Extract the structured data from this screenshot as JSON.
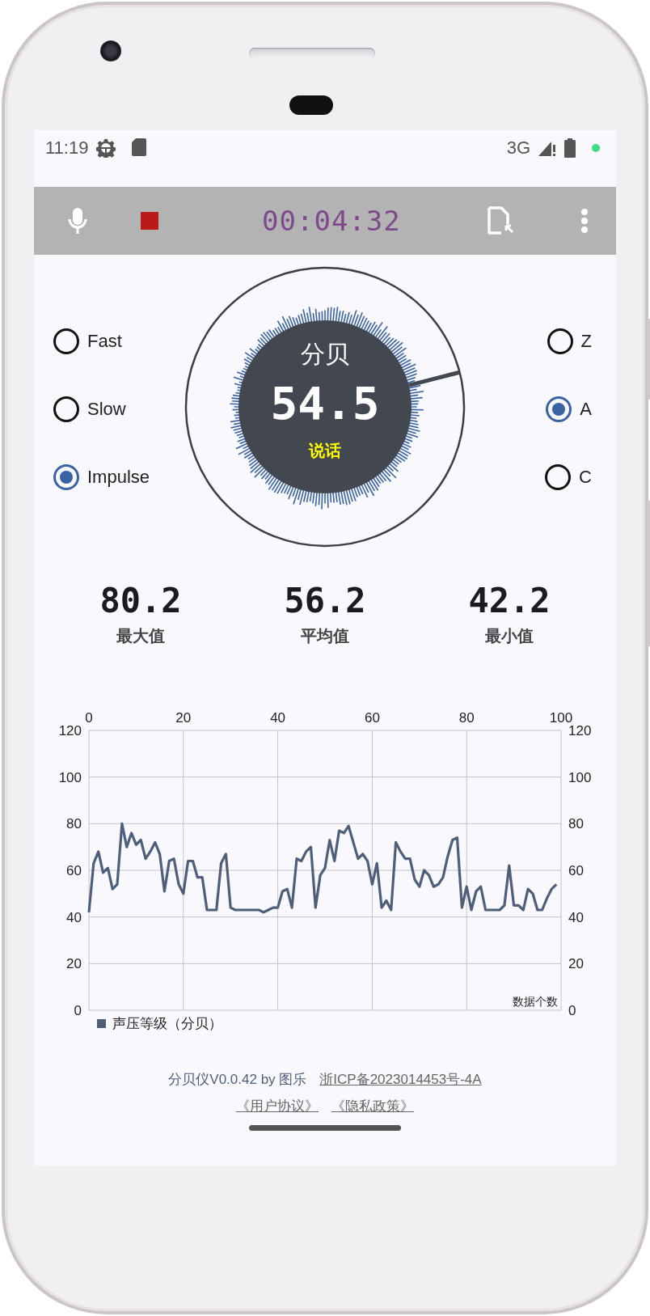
{
  "status_bar": {
    "time": "11:19",
    "network": "3G"
  },
  "app_bar": {
    "timer": "00:04:32",
    "recording": true
  },
  "response_options": [
    {
      "label": "Fast",
      "selected": false
    },
    {
      "label": "Slow",
      "selected": false
    },
    {
      "label": "Impulse",
      "selected": true
    }
  ],
  "weighting_options": [
    {
      "label": "Z",
      "selected": false
    },
    {
      "label": "A",
      "selected": true
    },
    {
      "label": "C",
      "selected": false
    }
  ],
  "gauge": {
    "unit": "分贝",
    "reading": "54.5",
    "description": "说话"
  },
  "stats": [
    {
      "value": "80.2",
      "label": "最大值"
    },
    {
      "value": "56.2",
      "label": "平均值"
    },
    {
      "value": "42.2",
      "label": "最小值"
    }
  ],
  "chart": {
    "right_axis_labels": [
      "120",
      "100",
      "80",
      "60",
      "40",
      "20",
      "0"
    ],
    "chart_data": {
      "type": "line",
      "xlabel": "数据个数",
      "grid": true,
      "x": [
        0,
        1,
        2,
        3,
        4,
        5,
        6,
        7,
        8,
        9,
        10,
        11,
        12,
        13,
        14,
        15,
        16,
        17,
        18,
        19,
        20,
        21,
        22,
        23,
        24,
        25,
        26,
        27,
        28,
        29,
        30,
        31,
        32,
        33,
        34,
        35,
        36,
        37,
        38,
        39,
        40,
        41,
        42,
        43,
        44,
        45,
        46,
        47,
        48,
        49,
        50,
        51,
        52,
        53,
        54,
        55,
        56,
        57,
        58,
        59,
        60,
        61,
        62,
        63,
        64,
        65,
        66,
        67,
        68,
        69,
        70,
        71,
        72,
        73,
        74,
        75,
        76,
        77,
        78,
        79,
        80,
        81,
        82,
        83,
        84,
        85,
        86,
        87,
        88,
        89,
        90,
        91,
        92,
        93,
        94,
        95,
        96,
        97,
        98,
        99
      ],
      "xlim": [
        0,
        100
      ],
      "ylim": [
        0,
        120
      ],
      "xticks": [
        0,
        20,
        40,
        60,
        80,
        100
      ],
      "yticks": [
        0,
        20,
        40,
        60,
        80,
        100,
        120
      ],
      "series": [
        {
          "name": "声压等级（分贝）",
          "color": "#4f5f7a",
          "values": [
            42,
            63,
            68,
            59,
            61,
            52,
            54,
            80,
            70,
            76,
            71,
            73,
            65,
            68,
            72,
            67,
            51,
            64,
            65,
            54,
            50,
            64,
            64,
            57,
            57,
            43,
            43,
            43,
            63,
            67,
            44,
            43,
            43,
            43,
            43,
            43,
            43,
            42,
            43,
            44,
            44,
            51,
            52,
            44,
            65,
            64,
            68,
            70,
            44,
            58,
            61,
            73,
            64,
            77,
            76,
            79,
            72,
            65,
            67,
            64,
            54,
            63,
            44,
            47,
            43,
            72,
            68,
            65,
            65,
            56,
            53,
            60,
            58,
            53,
            54,
            57,
            66,
            73,
            74,
            44,
            53,
            43,
            51,
            53,
            43,
            43,
            43,
            43,
            45,
            62,
            45,
            45,
            43,
            52,
            50,
            43,
            43,
            48,
            52,
            54
          ]
        }
      ]
    }
  },
  "footer": {
    "app_info": "分贝仪V0.0.42 by 图乐",
    "license_link": "浙ICP备2023014453号-4A",
    "links": [
      "《用户协议》",
      "《隐私政策》"
    ]
  }
}
